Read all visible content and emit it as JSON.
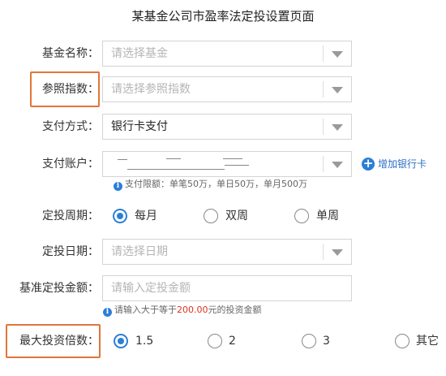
{
  "page": {
    "title": "某基金公司市盈率法定投设置页面"
  },
  "form": {
    "fund_name": {
      "label": "基金名称：",
      "placeholder": "请选择基金"
    },
    "index": {
      "label": "参照指数：",
      "placeholder": "请选择参照指数"
    },
    "payment_method": {
      "label": "支付方式：",
      "value": "银行卡支付"
    },
    "payment_account": {
      "label": "支付账户：",
      "add_bank_label": "增加银行卡",
      "hint": "支付限额：单笔50万，单日50万，单月500万"
    },
    "period": {
      "label": "定投周期：",
      "options": [
        "每月",
        "双周",
        "单周"
      ],
      "selected": "每月"
    },
    "date": {
      "label": "定投日期：",
      "placeholder": "请选择日期"
    },
    "base_amount": {
      "label": "基准定投金额：",
      "placeholder": "请输入定投金额",
      "hint_prefix": "请输入大于等于",
      "hint_amount": "200.00",
      "hint_suffix": "元的投资金额"
    },
    "max_multiple": {
      "label": "最大投资倍数：",
      "options": [
        "1.5",
        "2",
        "3",
        "其它"
      ],
      "selected": "1.5"
    }
  },
  "colors": {
    "accent": "#2b7fd6",
    "highlight_border": "#e2753a",
    "hint_amount": "#d9331f"
  }
}
